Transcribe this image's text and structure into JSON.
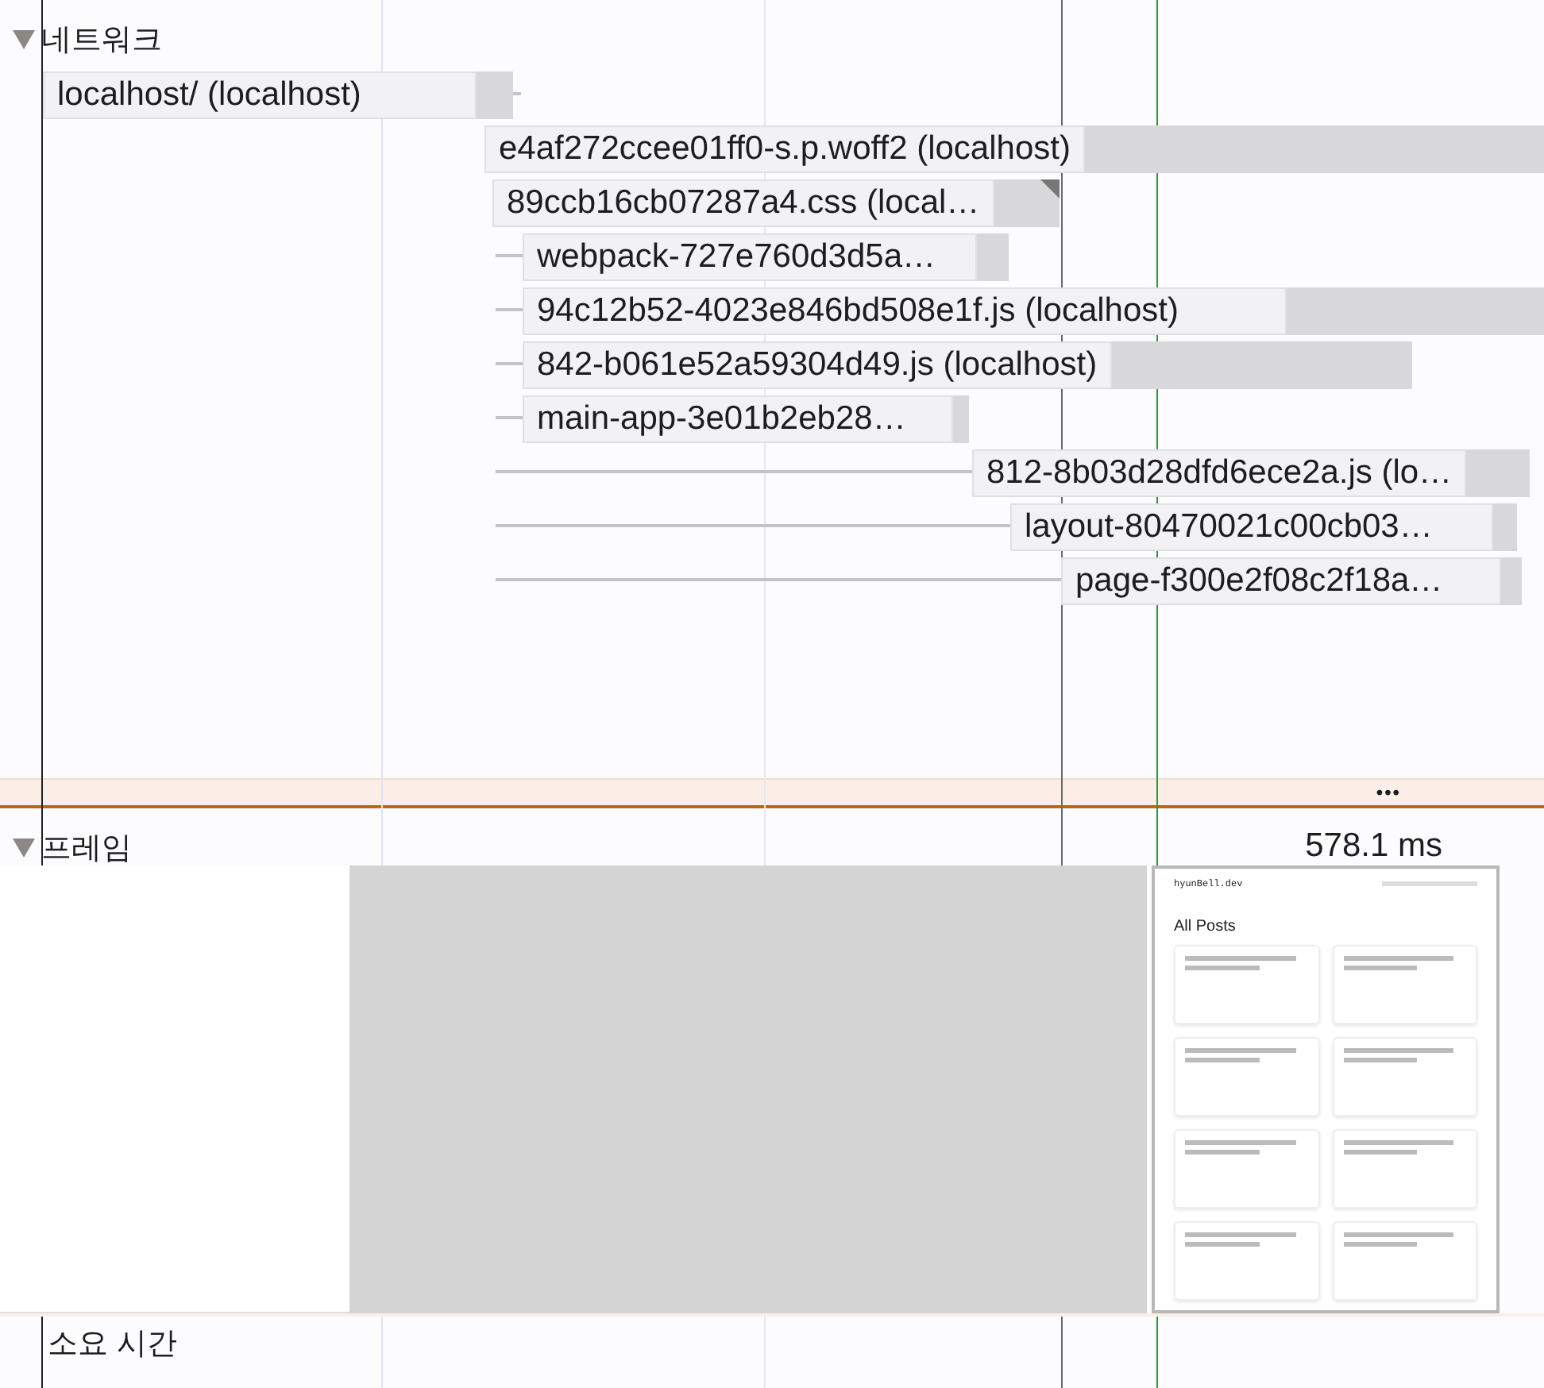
{
  "network": {
    "title": "네트워크",
    "expanded": true,
    "requests": [
      {
        "label": "localhost/ (localhost)"
      },
      {
        "label": "e4af272ccee01ff0-s.p.woff2 (localhost)"
      },
      {
        "label": "89ccb16cb07287a4.css (local…"
      },
      {
        "label": "webpack-727e760d3d5a…"
      },
      {
        "label": "94c12b52-4023e846bd508e1f.js (localhost)"
      },
      {
        "label": "842-b061e52a59304d49.js (localhost)"
      },
      {
        "label": "main-app-3e01b2eb28…"
      },
      {
        "label": "812-8b03d28dfd6ece2a.js (lo…"
      },
      {
        "label": "layout-80470021c00cb03…"
      },
      {
        "label": "page-f300e2f08c2f18a…"
      }
    ]
  },
  "more": "•••",
  "frames": {
    "title": "프레임",
    "expanded": true,
    "duration": "578.1 ms",
    "thumbnail": {
      "site": "hyunBell.dev",
      "heading": "All Posts"
    }
  },
  "duration_section": {
    "title": "소요 시간"
  }
}
